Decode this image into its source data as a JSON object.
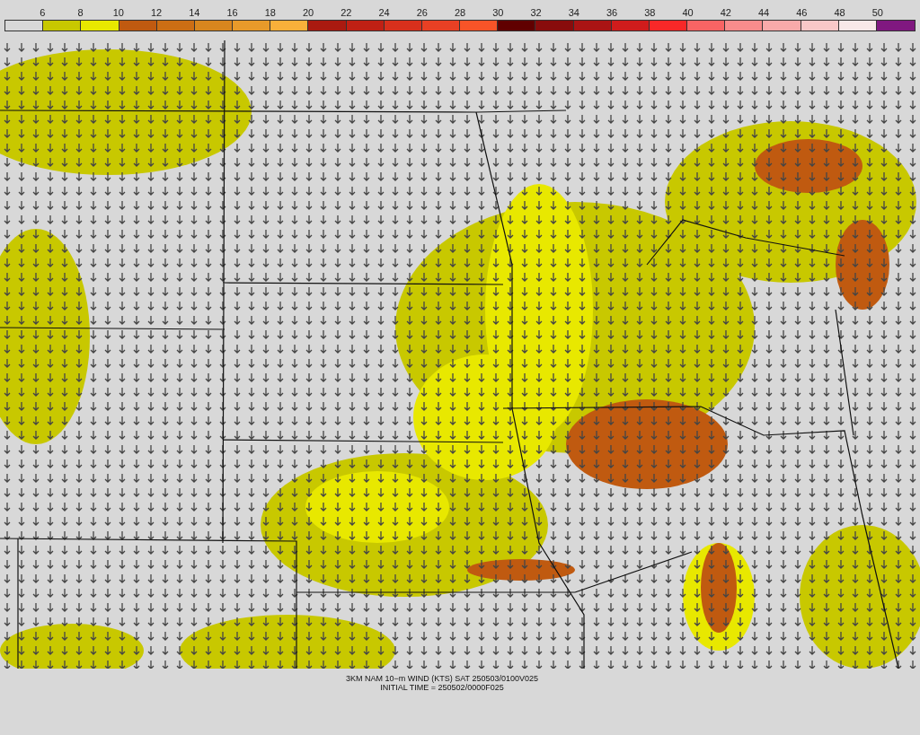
{
  "legend": {
    "labels": [
      "6",
      "8",
      "10",
      "12",
      "14",
      "16",
      "18",
      "20",
      "22",
      "24",
      "26",
      "28",
      "30",
      "32",
      "34",
      "36",
      "38",
      "40",
      "42",
      "44",
      "46",
      "48",
      "50"
    ],
    "swatches": [
      {
        "color": "#d8d8d8"
      },
      {
        "color": "#c8c800"
      },
      {
        "color": "#e8e800"
      },
      {
        "color": "#c05a10"
      },
      {
        "color": "#cc6e14"
      },
      {
        "color": "#d8861e"
      },
      {
        "color": "#e89a2a"
      },
      {
        "color": "#f8b03a"
      },
      {
        "color": "#aa1a10"
      },
      {
        "color": "#c02014"
      },
      {
        "color": "#d8301c"
      },
      {
        "color": "#e84024"
      },
      {
        "color": "#f85428"
      },
      {
        "color": "#600000"
      },
      {
        "color": "#880c0c"
      },
      {
        "color": "#aa1414"
      },
      {
        "color": "#d01c1c"
      },
      {
        "color": "#f82828"
      },
      {
        "color": "#f86464"
      },
      {
        "color": "#f88c8c"
      },
      {
        "color": "#f8aaaa"
      },
      {
        "color": "#f8c8c8"
      },
      {
        "color": "#f8e8e8"
      },
      {
        "color": "#801880"
      }
    ]
  },
  "caption": [
    "3KM NAM 10−m WIND (KTS) SAT 250503/0100V025",
    "INITIAL TIME = 250502/0000F025"
  ]
}
